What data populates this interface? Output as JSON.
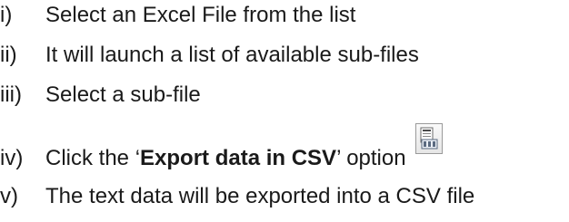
{
  "steps": [
    {
      "num": "i)",
      "text": "Select an Excel File from the list"
    },
    {
      "num": "ii)",
      "text": "It will launch a list of available sub-files"
    },
    {
      "num": "iii)",
      "text": "Select a sub-file"
    },
    {
      "num": "iv)",
      "prefix": "Click the ‘",
      "bold": "Export data in CSV",
      "suffix": "’ option",
      "icon": "export-csv-icon"
    },
    {
      "num": "v)",
      "text": "The text data will be exported into a CSV file"
    }
  ]
}
